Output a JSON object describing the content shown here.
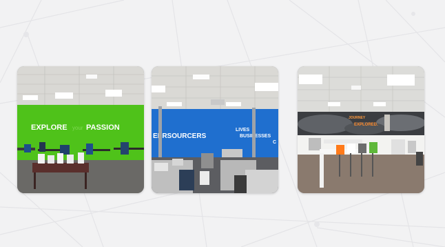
{
  "gallery": {
    "photos": [
      {
        "wall_text_primary": "EXPLORE",
        "wall_text_faint": "your",
        "wall_text_secondary": "PASSION",
        "wall_color": "#4fc21a"
      },
      {
        "wall_text_primary": "EERSOURCERS",
        "wall_text_right_1": "LIVES",
        "wall_text_right_2": "BUSINESSES",
        "wall_text_right_3": "C",
        "wall_color": "#1f6fcf"
      },
      {
        "wall_text_1": "JOURNEY",
        "wall_text_2": "EXPLORED.",
        "accent_color": "#ff7a1a"
      }
    ]
  },
  "colors": {
    "background": "#f2f2f3",
    "lines": "#e3e3e6"
  }
}
